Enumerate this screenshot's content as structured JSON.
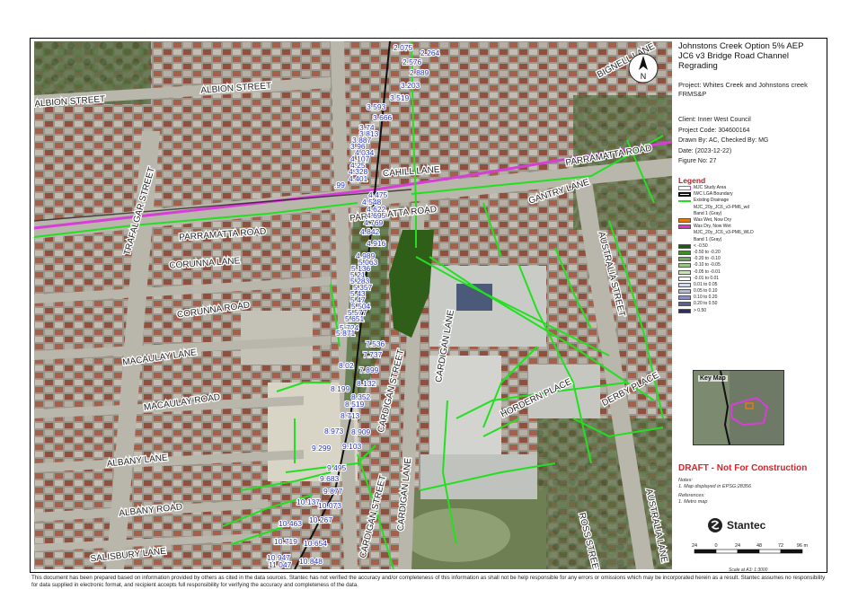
{
  "title_block": {
    "title_lines": [
      "Johnstons Creek Option 5% AEP",
      "JC6 v3 Bridge Road Channel",
      "Regrading"
    ],
    "project_label": "Project:",
    "project_value": "Whites Creek and Johnstons creek FRMS&P",
    "client": "Client: Inner West Council",
    "project_code": "Project Code: 304600164",
    "drawn_by": "Drawn By: AC, Checked By: MG",
    "date": "Date: (2023-12-22)",
    "figure_no": "Figure No: 27"
  },
  "legend": {
    "heading": "Legend",
    "items": [
      {
        "label": "MJC Study Area",
        "color": "#d63fd6",
        "style": "outline"
      },
      {
        "label": "IWC LGA Boundary",
        "color": "#111111",
        "style": "outline-thick"
      },
      {
        "label": "Existing Drainage",
        "color": "#22e020",
        "style": "line"
      },
      {
        "label": "MJC_20y_JC6_v3-PM6_wd",
        "color": "",
        "style": "title"
      },
      {
        "label": "Band 1 (Gray)",
        "color": "",
        "style": "sub"
      },
      {
        "label": "Was Wet, Now Dry",
        "color": "#e07a14",
        "style": "fill"
      },
      {
        "label": "Was Dry, Now Wet",
        "color": "#e62ec8",
        "style": "fill"
      },
      {
        "label": "MJC_20y_JC6_v3-PM6_WLD",
        "color": "",
        "style": "title"
      },
      {
        "label": "Band 1 (Gray)",
        "color": "",
        "style": "sub"
      },
      {
        "label": "< -0.50",
        "color": "#1b5e12",
        "style": "fill"
      },
      {
        "label": "-0.50 to -0.20",
        "color": "#3f8a2c",
        "style": "fill"
      },
      {
        "label": "-0.20 to -0.10",
        "color": "#6faa58",
        "style": "fill"
      },
      {
        "label": "-0.10 to -0.05",
        "color": "#9cc585",
        "style": "fill"
      },
      {
        "label": "-0.05 to -0.01",
        "color": "#c9e0b8",
        "style": "fill"
      },
      {
        "label": "-0.01 to 0.01",
        "color": "#ffffff",
        "style": "fill"
      },
      {
        "label": "0.01 to 0.05",
        "color": "#d8dcec",
        "style": "fill"
      },
      {
        "label": "0.05 to 0.10",
        "color": "#b3b9d8",
        "style": "fill"
      },
      {
        "label": "0.10 to 0.20",
        "color": "#8a90c0",
        "style": "fill"
      },
      {
        "label": "0.20 to 0.50",
        "color": "#5a5f9e",
        "style": "fill"
      },
      {
        "label": "> 0.50",
        "color": "#2a2c6e",
        "style": "fill"
      }
    ]
  },
  "key_map": {
    "label": "Key Map"
  },
  "draft_notice": "DRAFT - Not For Construction",
  "notes": {
    "heading": "Notes:",
    "line1": "1. Map displayed in EPSG:28356",
    "refs_heading": "References:",
    "ref1": "1. Metro map"
  },
  "logo_text": "Stantec",
  "scale": {
    "ticks": [
      "24",
      "0",
      "24",
      "48",
      "72",
      "96 m"
    ],
    "note": "Scale at A3: 1:3000"
  },
  "north_arrow_label": "N",
  "street_labels": [
    "ALBION STREET",
    "ALBION STREET",
    "TRAFALGAR STREET",
    "CAHILL LANE",
    "PARRAMATTA ROAD",
    "PARRAMATTA ROAD",
    "PARRAMATTA ROAD",
    "GANTRY LANE",
    "CORUNNA LANE",
    "CORUNNA ROAD",
    "AUSTRALIA STREET",
    "MACAULAY LANE",
    "MACAULAY ROAD",
    "CARDIGAN STREET",
    "CARDIGAN LANE",
    "HORDERN PLACE",
    "DERBY PLACE",
    "ALBANY LANE",
    "ALBANY ROAD",
    "CARDIGAN STREET",
    "CARDIGAN LANE",
    "SALISBURY LANE",
    "ROSS STREET",
    "AUSTRALIA LANE",
    "BIGNELL LANE"
  ],
  "level_labels": [
    "2.075",
    "2.264",
    "2.576",
    "2.889",
    "3.203",
    "3.519",
    "3.593",
    "3.666",
    "3.74",
    "3.813",
    "3.887",
    "3.96",
    "4.034",
    "4.107",
    "4.25",
    "4.328",
    "4.401",
    ".99",
    "4.475",
    "4.548",
    "4.622",
    "4.695",
    "4.769",
    "4.842",
    "4.916",
    "4.989",
    "5.063",
    "5.136",
    "5.21",
    "5.283",
    "5.357",
    "5.43",
    "5.47",
    "5.504",
    "5.577",
    "5.651",
    "5.724",
    "5.871",
    "7.536",
    "7.737",
    "8.02",
    "7.899",
    "8.132",
    "8.199",
    "8.352",
    "8.519",
    "8.713",
    "8.973",
    "8.909",
    "9.103",
    "9.299",
    "9.495",
    "9.683",
    "9.877",
    "10.137",
    "10.073",
    "10.463",
    "10.267",
    "10.719",
    "10.654",
    "10.947",
    "11.047",
    "10.848"
  ],
  "disclaimer": "This document has been prepared based on information provided by others as cited in the data sources. Stantec has not verified the accuracy and/or completeness of this information as shall not be help responsible for any errors or omissions which may be incorporated herein as a result. Stantec assumes no responsibility for data supplied in electronic format, and recipient accepts full responsibility for verifying the accuracy and completeness of the data."
}
